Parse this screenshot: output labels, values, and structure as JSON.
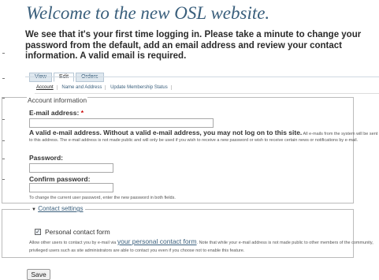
{
  "page_title": "Welcome to the new OSL website.",
  "intro_text": "We see that it's your first time logging in. Please take a minute to change your password from the default, add an email address and review your contact information. A valid email is required.",
  "tabs": [
    {
      "label": "View",
      "active": false
    },
    {
      "label": "Edit",
      "active": true
    },
    {
      "label": "Orders",
      "active": false
    }
  ],
  "subtabs": [
    {
      "label": "Account",
      "active": true
    },
    {
      "label": "Name and Address",
      "active": false
    },
    {
      "label": "Update Membership Status",
      "active": false
    }
  ],
  "account_info": {
    "legend": "Account information",
    "email_label": "E-mail address:",
    "email_required_mark": "*",
    "email_value": "",
    "email_desc_bold": "A valid e-mail address. Without a valid e-mail address, you may not log on to this site.",
    "email_desc_rest": "All e-mails from the system will be sent to this address. The e-mail address is not made public and will only be used if you wish to receive a new password or wish to receive certain news or notifications by e-mail.",
    "password_label": "Password:",
    "password_value": "",
    "confirm_label": "Confirm password:",
    "confirm_value": "",
    "password_desc": "To change the current user password, enter the new password in both fields."
  },
  "contact_settings": {
    "legend": "Contact settings",
    "collapse_arrow": "▼",
    "checkbox_label": "Personal contact form",
    "checkbox_checked": true,
    "checkbox_mark": "✓",
    "desc_before": "Allow other users to contact you by e-mail via",
    "desc_link": "your personal contact form",
    "desc_after": ". Note that while your e-mail address is not made public to other members of the community, privileged users such as site administrators are able to contact you even if you choose not to enable this feature."
  },
  "save_label": "Save",
  "colors": {
    "title": "#3a5f7c",
    "required": "#cc0000",
    "link": "#3a5f7c"
  }
}
